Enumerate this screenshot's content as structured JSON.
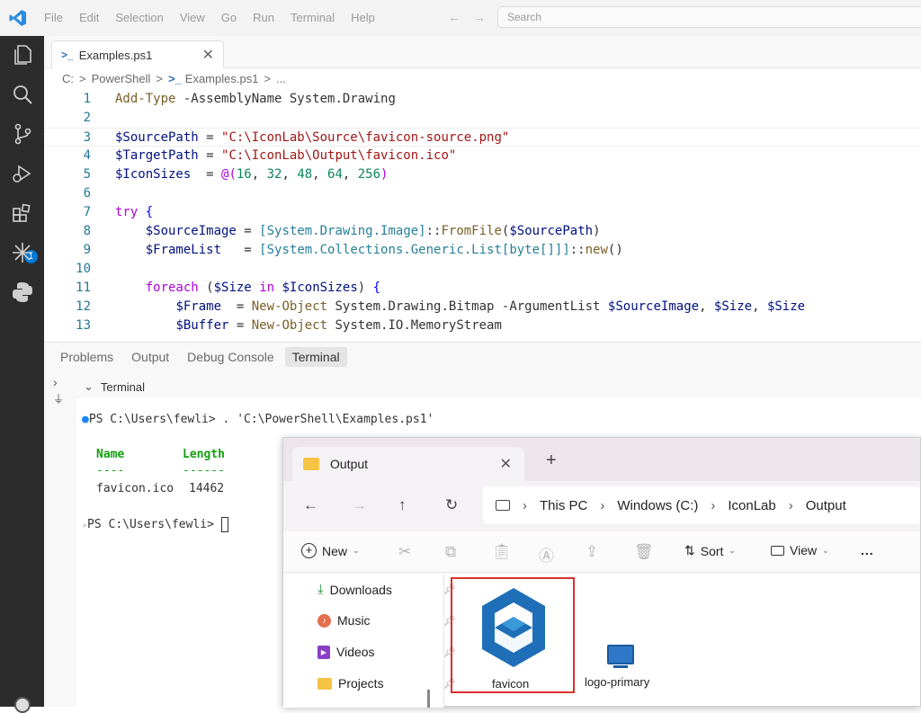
{
  "titlebar": {
    "menu": [
      "File",
      "Edit",
      "Selection",
      "View",
      "Go",
      "Run",
      "Terminal",
      "Help"
    ],
    "search_placeholder": "Search"
  },
  "activity_bar": {
    "extensions_badge": "1",
    "icons": [
      "explorer-icon",
      "search-icon",
      "source-control-icon",
      "run-debug-icon",
      "extensions-icon",
      "copilot-icon",
      "python-icon"
    ]
  },
  "editor": {
    "tab_label": "Examples.ps1",
    "breadcrumb": [
      "C:",
      ">",
      "PowerShell",
      ">",
      "Examples.ps1",
      ">",
      "..."
    ],
    "line_numbers": [
      "1",
      "2",
      "3",
      "4",
      "5",
      "6",
      "7",
      "8",
      "9",
      "10",
      "11",
      "12",
      "13"
    ]
  },
  "panel": {
    "tabs": [
      "Problems",
      "Output",
      "Debug Console",
      "Terminal"
    ],
    "active_tab": "Terminal",
    "terminal_header": "Terminal",
    "terminal": {
      "prompt1": "PS C:\\Users\\fewli> ",
      "cmd1": ". 'C:\\PowerShell\\Examples.ps1'",
      "col_name": "Name",
      "col_length": "Length",
      "dash_name": "----",
      "dash_length": "------",
      "row_name": "favicon.ico",
      "row_length": "14462",
      "prompt2": "PS C:\\Users\\fewli> "
    }
  },
  "explorer": {
    "tab_title": "Output",
    "address": [
      "This PC",
      "Windows (C:)",
      "IconLab",
      "Output"
    ],
    "toolbar": {
      "new_label": "New",
      "sort_label": "Sort",
      "view_label": "View",
      "more_label": "..."
    },
    "sidebar": [
      {
        "label": "Downloads"
      },
      {
        "label": "Music"
      },
      {
        "label": "Videos"
      },
      {
        "label": "Projects"
      }
    ],
    "files": [
      {
        "name": "favicon"
      },
      {
        "name": "logo-primary"
      }
    ]
  }
}
